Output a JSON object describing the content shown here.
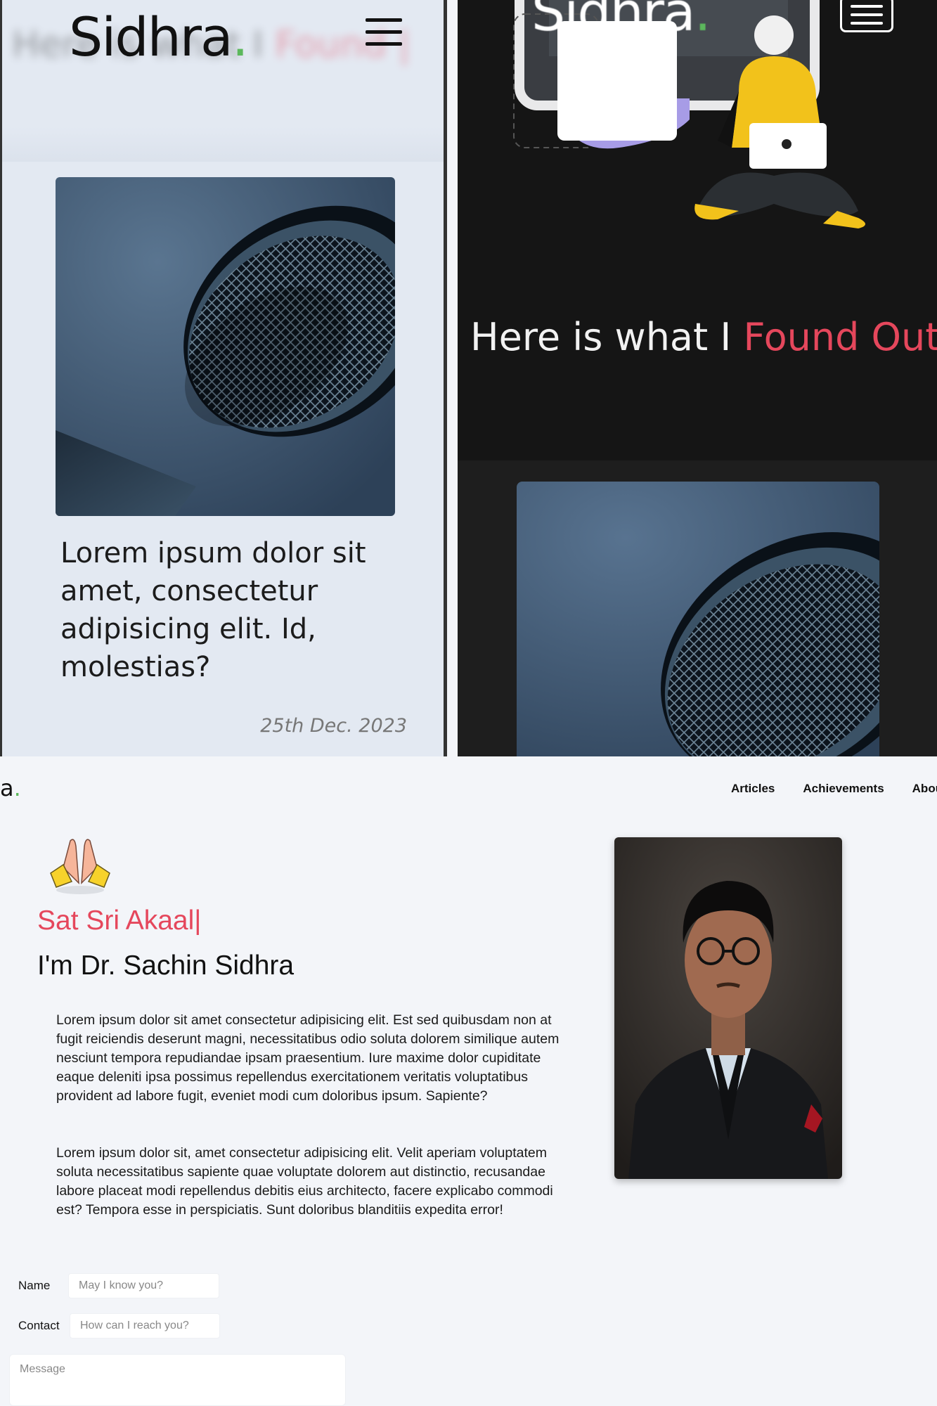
{
  "mobile_light": {
    "ghost_text": "Here is what I Found |",
    "ghost_text_plain": "Here is what I ",
    "ghost_text_red": "Found |",
    "logo": "Sidhra",
    "logo_dot": ".",
    "menu_icon": "hamburger-icon",
    "card": {
      "image": "microphone",
      "title": "Lorem ipsum dolor sit amet, consectetur adipisicing elit. Id, molestias?",
      "date": "25th Dec. 2023"
    }
  },
  "mobile_dark": {
    "logo": "Sidhra",
    "logo_dot": ".",
    "menu_icon": "hamburger-icon",
    "hero_illustration": "person-with-laptop",
    "title_plain": "Here is what I ",
    "title_red": "Found Out",
    "card_image": "microphone"
  },
  "desktop": {
    "logo_fragment": "a",
    "logo_dot": ".",
    "nav": [
      "Articles",
      "Achievements",
      "About"
    ],
    "greeting_icon": "folded-hands-icon",
    "greeting": "Sat Sri Akaal|",
    "name": "I'm Dr. Sachin Sidhra",
    "paragraph1": "Lorem ipsum dolor sit amet consectetur adipisicing elit. Est sed quibusdam non at fugit reiciendis deserunt magni, necessitatibus odio soluta dolorem similique autem nesciunt tempora repudiandae ipsam praesentium. Iure maxime dolor cupiditate eaque deleniti ipsa possimus repellendus exercitationem veritatis voluptatibus provident ad labore fugit, eveniet modi cum doloribus ipsum. Sapiente?",
    "paragraph2": "Lorem ipsum dolor sit, amet consectetur adipisicing elit. Velit aperiam voluptatem soluta necessitatibus sapiente quae voluptate dolorem aut distinctio, recusandae labore placeat modi repellendus debitis eius architecto, facere explicabo commodi est? Tempora esse in perspiciatis. Sunt doloribus blanditiis expedita error!",
    "portrait": "profile-photo",
    "form": {
      "name_label": "Name",
      "name_placeholder": "May I know you?",
      "contact_label": "Contact",
      "contact_placeholder": "How can I reach you?",
      "message_placeholder": "Message"
    }
  },
  "colors": {
    "accent_red": "#e5475c",
    "dot_green": "#5cb85c",
    "dark_bg": "#151515",
    "light_bg": "#e3e9f2"
  }
}
